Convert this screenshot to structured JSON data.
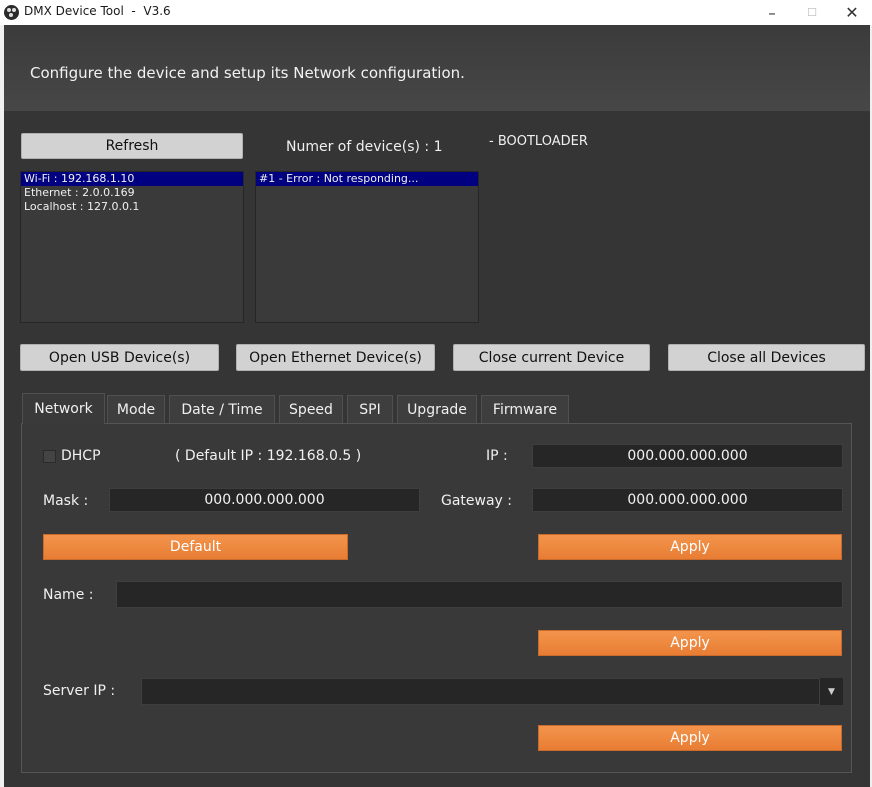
{
  "window": {
    "title": "DMX Device Tool  -  V3.6",
    "minimize": "–",
    "maximize": "☐",
    "close": "✕"
  },
  "header": {
    "text": "Configure the device and setup its Network configuration."
  },
  "top": {
    "refresh_label": "Refresh",
    "device_count_label": "Numer of device(s) : 1",
    "status": "- BOOTLOADER",
    "interfaces": [
      "Wi-Fi : 192.168.1.10",
      "Ethernet : 2.0.0.169",
      "Localhost : 127.0.0.1"
    ],
    "devices": [
      "#1 - Error : Not responding..."
    ]
  },
  "actions": {
    "open_usb": "Open USB Device(s)",
    "open_ethernet": "Open Ethernet Device(s)",
    "close_current": "Close current Device",
    "close_all": "Close all Devices"
  },
  "tabs": [
    "Network",
    "Mode",
    "Date / Time",
    "Speed",
    "SPI",
    "Upgrade",
    "Firmware"
  ],
  "network": {
    "dhcp_label": "DHCP",
    "dhcp_checked": false,
    "default_ip_note": "( Default IP : 192.168.0.5 )",
    "ip_label": "IP :",
    "ip_value": "000.000.000.000",
    "mask_label": "Mask :",
    "mask_value": "000.000.000.000",
    "gateway_label": "Gateway :",
    "gateway_value": "000.000.000.000",
    "default_button": "Default",
    "apply_button": "Apply",
    "name_label": "Name :",
    "name_value": "",
    "apply_name_button": "Apply",
    "server_ip_label": "Server IP :",
    "server_ip_value": "",
    "apply_server_button": "Apply"
  },
  "colors": {
    "accent": "#f08a42",
    "selection": "#000080",
    "background": "#353535"
  }
}
